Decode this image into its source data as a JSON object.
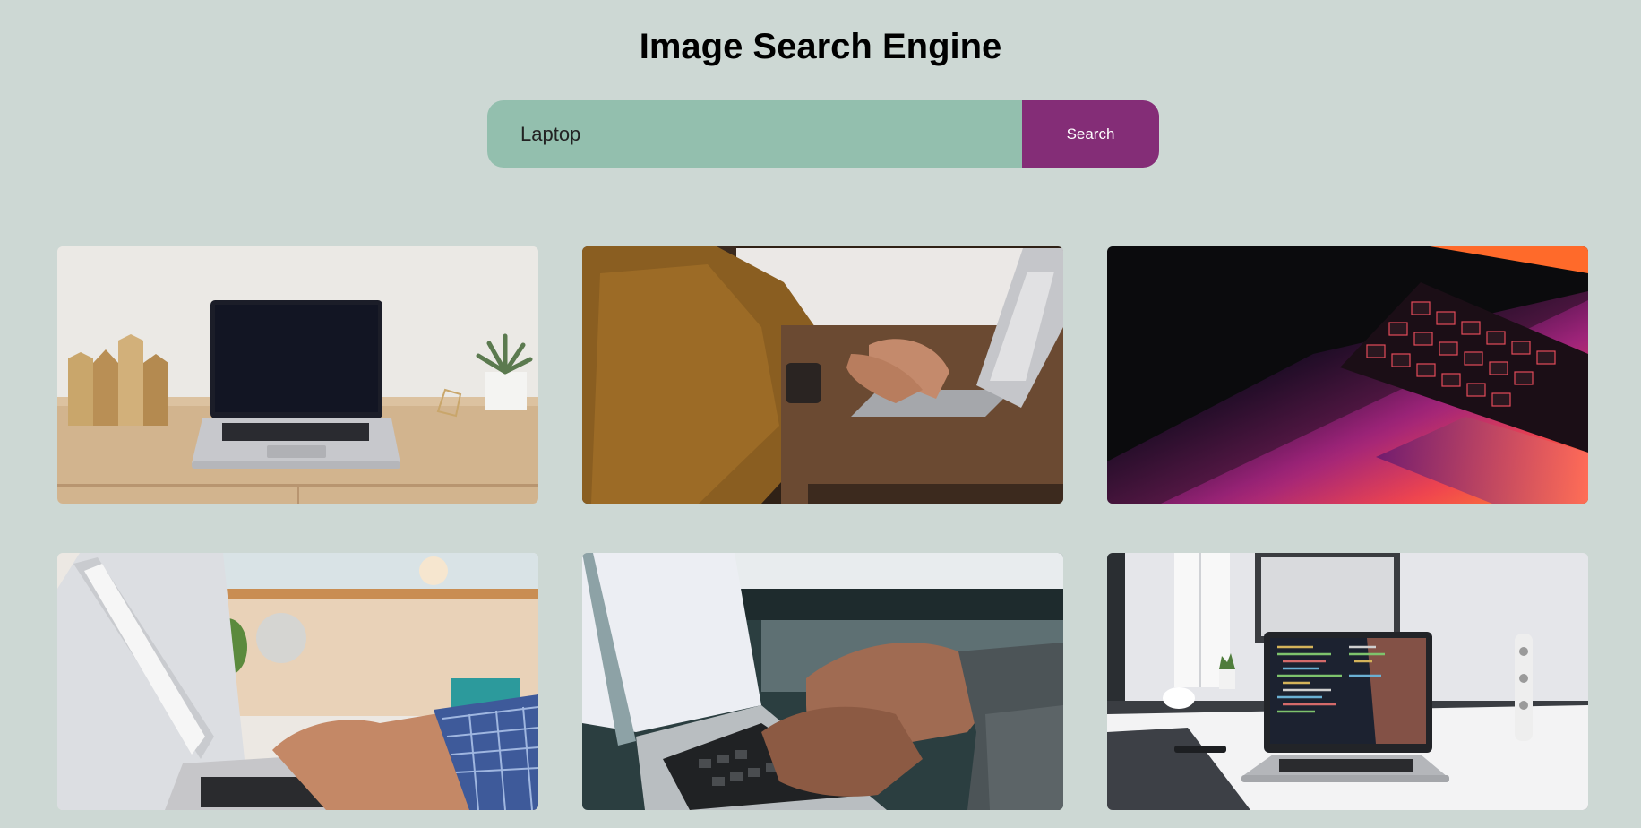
{
  "header": {
    "title": "Image Search Engine"
  },
  "search": {
    "value": "Laptop",
    "button_label": "Search"
  },
  "colors": {
    "background": "#cdd8d4",
    "input_bg": "#93bfae",
    "button_bg": "#842d77"
  },
  "results": [
    {
      "subject": "laptop on wooden desk with gold decor and plant"
    },
    {
      "subject": "person in mustard sweater typing on laptop"
    },
    {
      "subject": "laptop keyboard close-up with purple orange light"
    },
    {
      "subject": "hands typing on laptop in bright office"
    },
    {
      "subject": "hands typing on laptop keyboard close-up"
    },
    {
      "subject": "laptop showing code on white desk"
    }
  ]
}
